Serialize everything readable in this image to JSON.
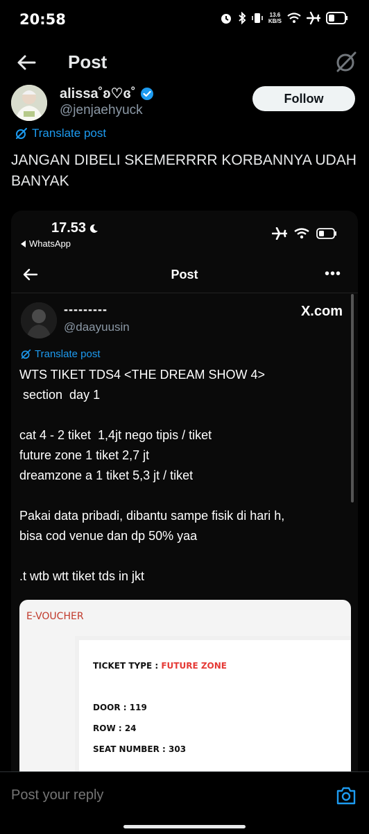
{
  "status_bar": {
    "time": "20:58",
    "speed_top": "13.6",
    "speed_bottom": "KB/S"
  },
  "nav": {
    "title": "Post"
  },
  "author": {
    "name": "alissa˚ʚ♡ɞ˚",
    "handle": "@jenjaehyuck",
    "follow_label": "Follow",
    "verified_color": "#1d9bf0"
  },
  "post": {
    "translate_label": "Translate post",
    "text": "JANGAN DIBELI SKEMERRRR KORBANNYA UDAH BANYAK"
  },
  "screenshot": {
    "time": "17.53",
    "back_app": "WhatsApp",
    "nav_title": "Post",
    "more": "•••",
    "name": "---------",
    "handle": "@daayuusin",
    "watermark": "X.com",
    "translate_label": "Translate post",
    "text": "WTS TIKET TDS4 <THE DREAM SHOW 4>\n section  day 1\n\ncat 4 - 2 tiket  1,4jt nego tipis / tiket\nfuture zone 1 tiket 2,7 jt\ndreamzone a 1 tiket 5,3 jt / tiket\n\nPakai data pribadi, dibantu sampe fisik di hari h,\nbisa cod venue dan dp 50% yaa\n\n.t wtb wtt tiket tds in jkt",
    "voucher": {
      "header": "E-VOUCHER",
      "ticket_type_label": "TICKET TYPE : ",
      "ticket_type_value": "FUTURE ZONE",
      "door": "DOOR : 119",
      "row": "ROW : 24",
      "seat": "SEAT NUMBER : 303"
    }
  },
  "reply": {
    "placeholder": "Post your reply"
  },
  "colors": {
    "accent": "#1d9bf0",
    "background": "#000000"
  }
}
